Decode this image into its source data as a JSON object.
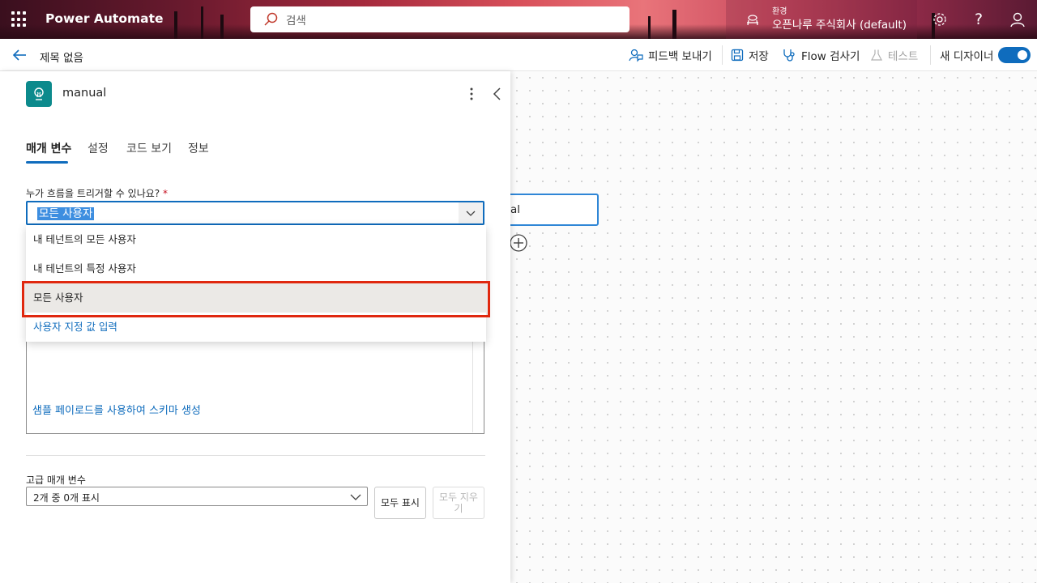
{
  "app": {
    "name": "Power Automate"
  },
  "search": {
    "placeholder": "검색"
  },
  "environment": {
    "label": "환경",
    "name": "오픈나루 주식회사 (default)"
  },
  "header_icons": [
    "settings-icon",
    "help-icon",
    "account-icon"
  ],
  "toolbar": {
    "flow_title": "제목 없음",
    "feedback_label": "피드백 보내기",
    "save_label": "저장",
    "checker_label": "Flow 검사기",
    "test_label": "테스트",
    "new_designer_label": "새 디자이너",
    "new_designer_on": true
  },
  "panel": {
    "trigger_name": "manual",
    "tabs": [
      "매개 변수",
      "설정",
      "코드 보기",
      "정보"
    ],
    "active_tab": 0,
    "who_can_trigger": {
      "label": "누가 흐름을 트리거할 수 있나요?",
      "required_mark": "*",
      "value": "모든 사용자",
      "options": [
        "내 테넌트의 모든 사용자",
        "내 테넌트의 특정 사용자",
        "모든 사용자",
        "사용자 지정 값 입력"
      ],
      "highlighted_index": 2
    },
    "schema_link": "샘플 페이로드를 사용하여 스키마 생성",
    "advanced": {
      "label": "고급 매개 변수",
      "select_value": "2개 중 0개 표시",
      "show_all_label": "모두 표시",
      "clear_all_label": "모두 지우기"
    }
  },
  "canvas": {
    "node_label_visible": "al"
  },
  "colors": {
    "accent": "#0f6cbd",
    "highlight_border": "#e0280f",
    "trigger_icon_bg": "#0c8a8c"
  }
}
